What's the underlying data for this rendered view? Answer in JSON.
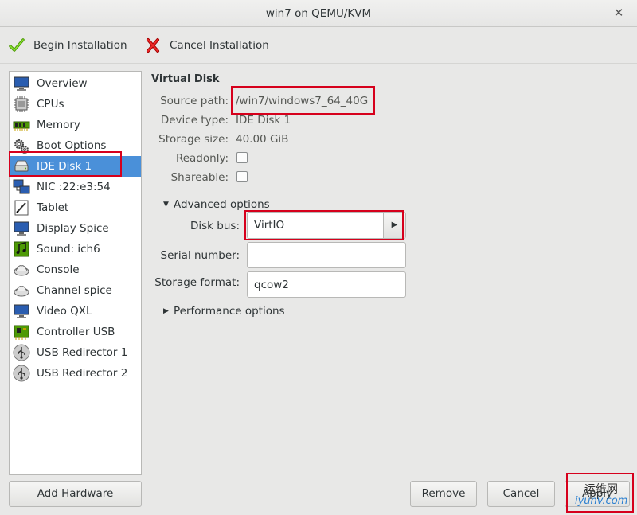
{
  "window": {
    "title": "win7 on QEMU/KVM"
  },
  "toolbar": {
    "begin_label": "Begin Installation",
    "cancel_label": "Cancel Installation",
    "begin_icon": "green-check-icon",
    "cancel_icon": "red-x-icon"
  },
  "sidebar": {
    "items": [
      {
        "label": "Overview",
        "icon": "monitor-icon"
      },
      {
        "label": "CPUs",
        "icon": "cpu-icon"
      },
      {
        "label": "Memory",
        "icon": "memory-icon"
      },
      {
        "label": "Boot Options",
        "icon": "gears-icon"
      },
      {
        "label": "IDE Disk 1",
        "icon": "disk-icon",
        "selected": true
      },
      {
        "label": "NIC :22:e3:54",
        "icon": "network-icon"
      },
      {
        "label": "Tablet",
        "icon": "tablet-icon"
      },
      {
        "label": "Display Spice",
        "icon": "display-icon"
      },
      {
        "label": "Sound: ich6",
        "icon": "sound-icon"
      },
      {
        "label": "Console",
        "icon": "console-icon"
      },
      {
        "label": "Channel spice",
        "icon": "channel-icon"
      },
      {
        "label": "Video QXL",
        "icon": "video-icon"
      },
      {
        "label": "Controller USB",
        "icon": "controller-icon"
      },
      {
        "label": "USB Redirector 1",
        "icon": "usb-icon"
      },
      {
        "label": "USB Redirector 2",
        "icon": "usb-icon"
      }
    ],
    "add_hardware_label": "Add Hardware"
  },
  "disk": {
    "section_title": "Virtual Disk",
    "source_path_label": "Source path:",
    "source_path": "/win7/windows7_64_40G",
    "device_type_label": "Device type:",
    "device_type": "IDE Disk 1",
    "storage_size_label": "Storage size:",
    "storage_size": "40.00 GiB",
    "readonly_label": "Readonly:",
    "readonly": false,
    "shareable_label": "Shareable:",
    "shareable": false
  },
  "advanced": {
    "label": "Advanced options",
    "expanded": true,
    "disk_bus_label": "Disk bus:",
    "disk_bus": "VirtIO",
    "serial_label": "Serial number:",
    "serial_value": "",
    "storage_format_label": "Storage format:",
    "storage_format": "qcow2"
  },
  "performance": {
    "label": "Performance options",
    "expanded": false
  },
  "buttons": {
    "remove": "Remove",
    "cancel": "Cancel",
    "apply": "Apply"
  },
  "watermark": {
    "line1": "运维网",
    "line2": "iyunv.com"
  },
  "colors": {
    "selection": "#4a90d9",
    "highlight_box": "#d6001c"
  }
}
